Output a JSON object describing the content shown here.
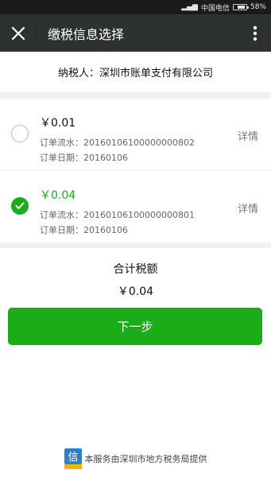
{
  "status_bar": {
    "carrier": "中国电信",
    "battery": "58%",
    "battery_level": 0.58
  },
  "nav": {
    "title": "缴税信息选择"
  },
  "taxpayer": {
    "text": "纳税人：深圳市账单支付有限公司"
  },
  "orders": [
    {
      "selected": false,
      "amount": "￥0.01",
      "serial": "订单流水：20160106100000000802",
      "date": "订单日期：20160106",
      "detail_label": "详情"
    },
    {
      "selected": true,
      "amount": "￥0.04",
      "serial": "订单流水：20160106100000000801",
      "date": "订单日期：20160106",
      "detail_label": "详情"
    }
  ],
  "total": {
    "label": "合计税额",
    "value": "￥0.04"
  },
  "next_button": {
    "label": "下一步"
  },
  "footer": {
    "text": "本服务由深圳市地方税务局提供",
    "logo_text": "信"
  },
  "colors": {
    "accent": "#1aad19",
    "nav_bg": "#2e3132"
  }
}
